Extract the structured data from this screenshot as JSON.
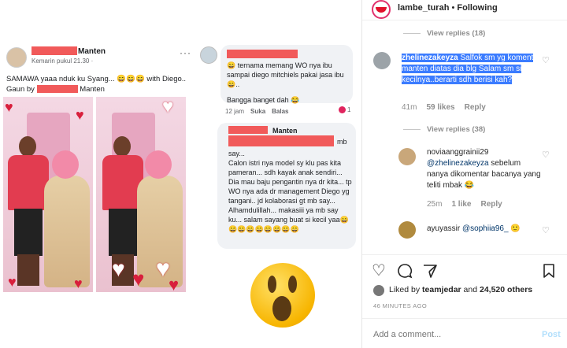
{
  "left": {
    "fbpost": {
      "name_suffix": "Manten",
      "time": "Kemarin pukul 21.30 · ",
      "dots": "···",
      "text_line1": "SAMAWA yaaa nduk ku Syang... 😄😄😄 with Diego..",
      "text_line2a": "Gaun by ",
      "text_line2b": " Manten"
    },
    "comment1": {
      "text": "😄 ternama memang WO nya ibu sampai diego mitchiels pakai jasa ibu 😄..",
      "text2": "Bangga banget dah 😂",
      "time": "12 jam",
      "like": "Suka",
      "reply": "Balas",
      "count": "1"
    },
    "comment2": {
      "name_suffix": "Manten",
      "mb": "mb",
      "body": "say...\nCalon istri nya model sy klu pas kita pameran... sdh kayak anak sendiri...\nDia mau baju pengantin nya dr kita... tp WO nya ada dr management Diego yg tangani.. jd kolaborasi gt mb say...\nAlhamdulillah... makasiii ya mb say ku... salam sayang buat si kecil yaa😄😄😄😄😄😄😄😄😄"
    }
  },
  "header": {
    "username": "lambe_turah",
    "separator": " • ",
    "following": "Following"
  },
  "thread": {
    "view_replies_1": "View replies (18)",
    "c1": {
      "user": "zhelinezakeyza",
      "text": "Salfok sm yg koment manten diatas dia blg Salam sm si kecilnya..berarti sdh berisi kah?",
      "time": "41m",
      "likes": "59 likes",
      "reply": "Reply"
    },
    "view_replies_2": "View replies (38)",
    "c2": {
      "user": "noviaanggrainii29",
      "mention": "@zhelinezakeyza",
      "text": " sebelum nanya dikomentar bacanya yang teliti mbak 😂",
      "time": "25m",
      "likes": "1 like",
      "reply": "Reply"
    },
    "c3": {
      "user": "ayuyassir",
      "mention": "@sophiia96_",
      "text": " 🙂"
    }
  },
  "actions": {
    "liked_prefix": "Liked by ",
    "liked_user": "teamjedar",
    "liked_and": " and ",
    "liked_count": "24,520 others",
    "ago": "46 MINUTES AGO",
    "add_comment_placeholder": "Add a comment...",
    "post": "Post"
  },
  "colors": {
    "highlight": "#3b7cff",
    "redaction": "#f15a5a",
    "instagram_red": "#e1306c"
  },
  "icons": [
    "heart-outline-icon",
    "comment-icon",
    "share-icon",
    "bookmark-icon"
  ]
}
